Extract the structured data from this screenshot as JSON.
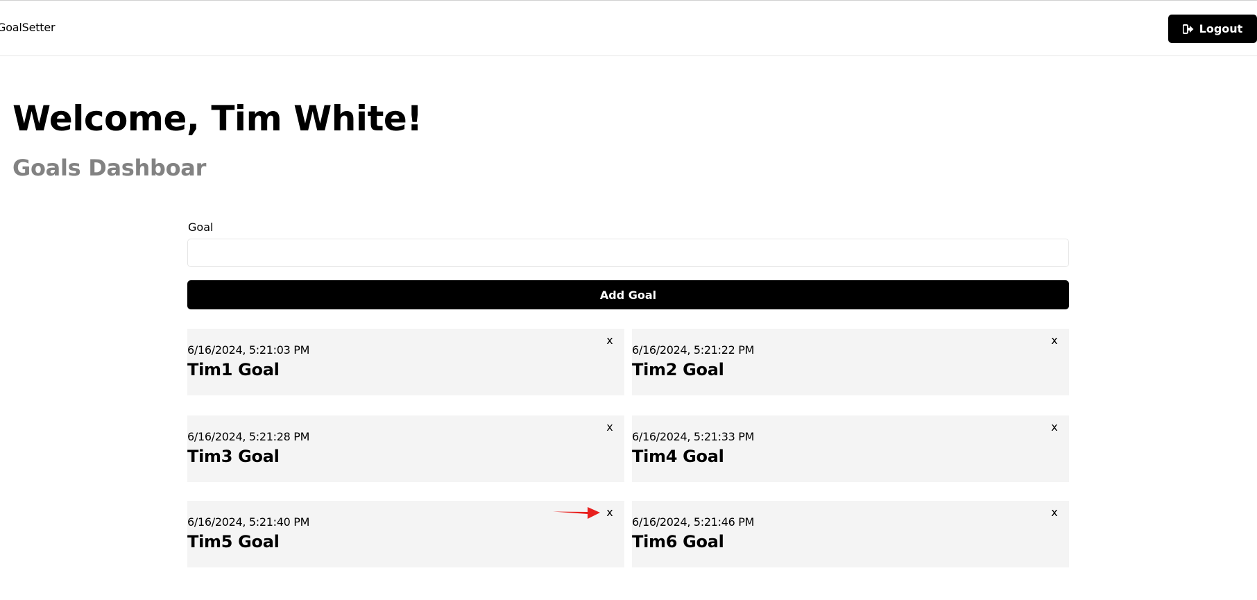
{
  "app": {
    "brand": "GoalSetter",
    "logout_label": "Logout"
  },
  "main": {
    "welcome": "Welcome, Tim White!",
    "subtitle": "Goals Dashboar",
    "form": {
      "goal_label": "Goal",
      "goal_value": "",
      "goal_placeholder": "",
      "submit_label": "Add Goal"
    }
  },
  "goals": [
    {
      "date": "6/16/2024, 5:21:03 PM",
      "text": "Tim1 Goal",
      "close": "x"
    },
    {
      "date": "6/16/2024, 5:21:22 PM",
      "text": "Tim2 Goal",
      "close": "x"
    },
    {
      "date": "6/16/2024, 5:21:28 PM",
      "text": "Tim3 Goal",
      "close": "x"
    },
    {
      "date": "6/16/2024, 5:21:33 PM",
      "text": "Tim4 Goal",
      "close": "x"
    },
    {
      "date": "6/16/2024, 5:21:40 PM",
      "text": "Tim5 Goal",
      "close": "x"
    },
    {
      "date": "6/16/2024, 5:21:46 PM",
      "text": "Tim6 Goal",
      "close": "x"
    }
  ],
  "icons": {
    "logout": "logout-icon",
    "annotation": "red-arrow-icon"
  },
  "colors": {
    "button_bg": "#000000",
    "card_bg": "#f4f4f4",
    "subtitle": "#828282",
    "annotation": "#e8201e"
  }
}
